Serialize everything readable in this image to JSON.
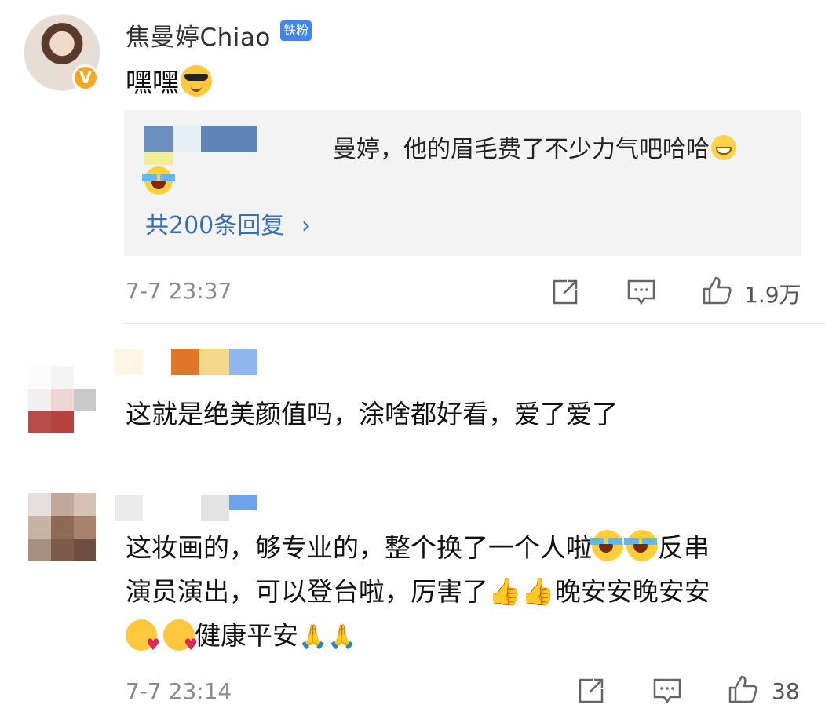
{
  "post": {
    "username": "焦曼婷Chiao",
    "badge": "铁粉",
    "comment": "嘿嘿",
    "reply": {
      "text": "曼婷，他的眉毛费了不少力气吧哈哈",
      "count_label": "共200条回复",
      "chevron": "›"
    },
    "time": "7-7 23:37",
    "likes": "1.9万"
  },
  "comment2": {
    "text": "这就是绝美颜值吗，涂啥都好看，爱了爱了"
  },
  "comment3": {
    "line1": "这妆画的，够专业的，整个换了一个人啦",
    "line1_tail": "反串",
    "line2": "演员演出，可以登台啦，厉害了",
    "line2_tail": "晚安安晚安安",
    "line3": "健康平安",
    "time": "7-7 23:14",
    "likes": "38"
  },
  "colors": {
    "link_blue": "#3a6fb0",
    "badge_blue": "#3f86f2",
    "verified_gold": "#f5a623"
  },
  "icons": [
    "share-icon",
    "comment-icon",
    "like-icon",
    "verified-icon",
    "cool-emoji",
    "grin-emoji",
    "laugh-cry-emoji",
    "thumbs-up-emoji",
    "kiss-emoji",
    "pray-emoji"
  ]
}
